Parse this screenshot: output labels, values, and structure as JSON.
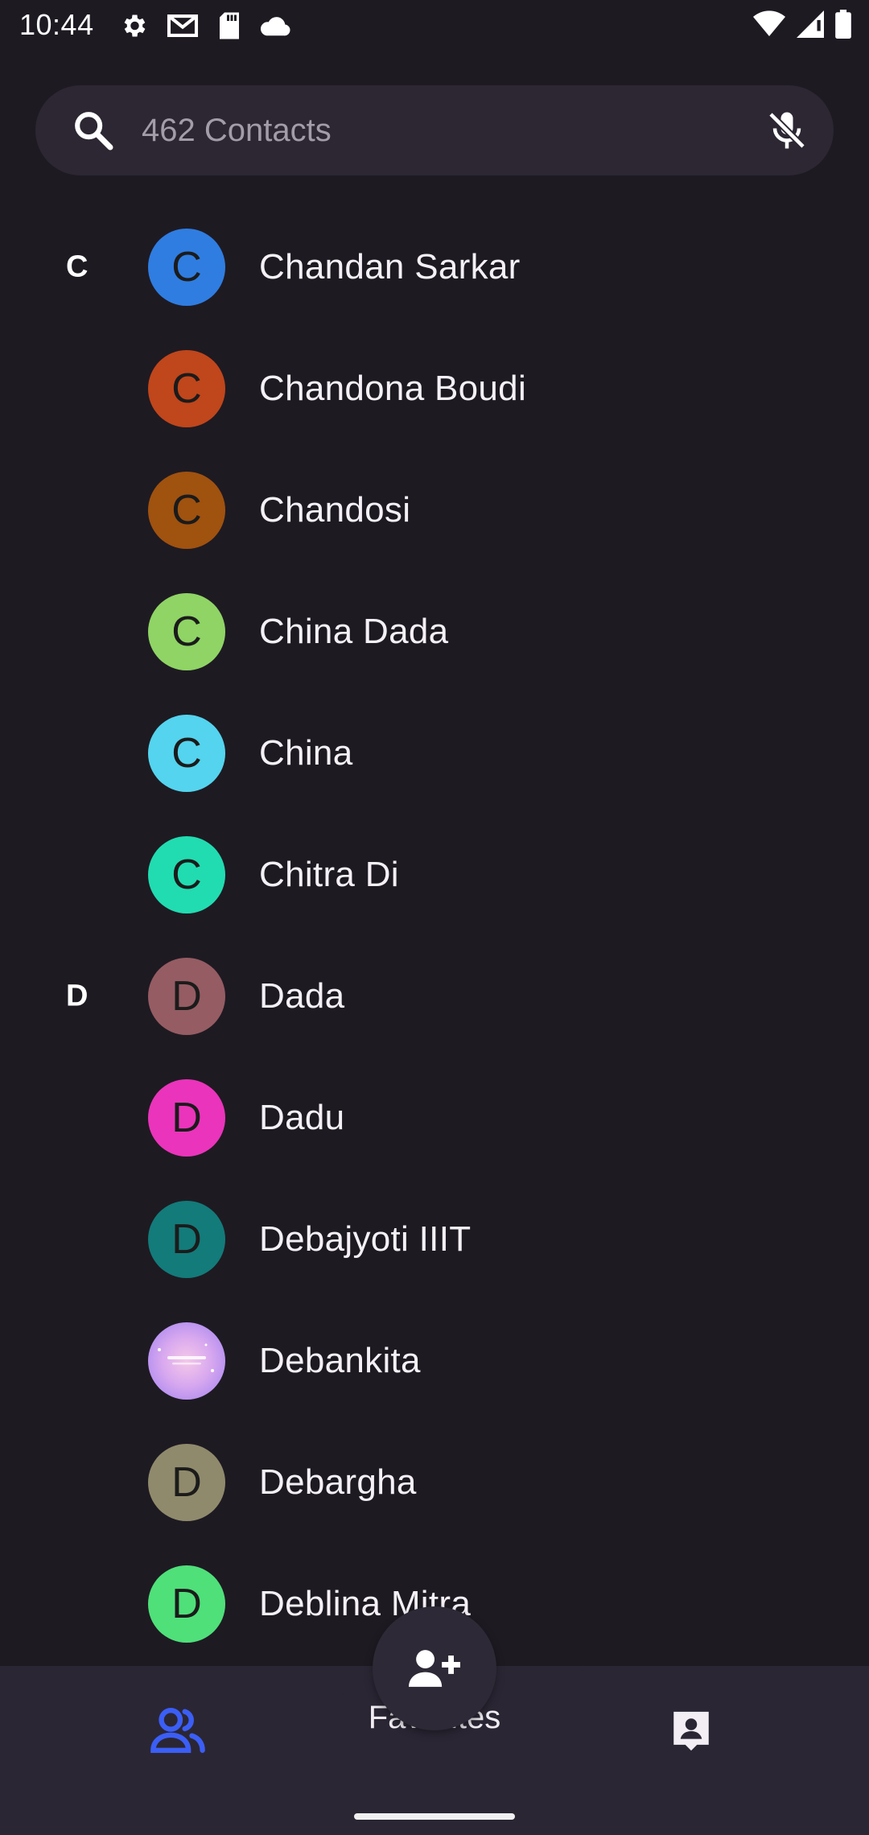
{
  "status_bar": {
    "time": "10:44",
    "left_icons": [
      "settings-icon",
      "gmail-icon",
      "sd-card-icon",
      "cloud-icon"
    ],
    "right_icons": [
      "wifi-icon",
      "signal-icon",
      "battery-icon"
    ]
  },
  "search": {
    "placeholder": "462 Contacts",
    "value": "",
    "mic_icon": "mic-off-icon"
  },
  "contacts": [
    {
      "section": "C",
      "initial": "C",
      "name": "Chandan Sarkar",
      "color": "#2f7de1"
    },
    {
      "section": "",
      "initial": "C",
      "name": "Chandona Boudi",
      "color": "#c0461b"
    },
    {
      "section": "",
      "initial": "C",
      "name": "Chandosi",
      "color": "#a0520f"
    },
    {
      "section": "",
      "initial": "C",
      "name": "China Dada",
      "color": "#8fd465"
    },
    {
      "section": "",
      "initial": "C",
      "name": "China",
      "color": "#54d4ee"
    },
    {
      "section": "",
      "initial": "C",
      "name": "Chitra Di",
      "color": "#21dcb1"
    },
    {
      "section": "D",
      "initial": "D",
      "name": "Dada",
      "color": "#955c63"
    },
    {
      "section": "",
      "initial": "D",
      "name": "Dadu",
      "color": "#ea34bb"
    },
    {
      "section": "",
      "initial": "D",
      "name": "Debajyoti IIIT",
      "color": "#137b7a"
    },
    {
      "section": "",
      "initial": "",
      "name": "Debankita",
      "color": "#d7a7ef",
      "photo": true
    },
    {
      "section": "",
      "initial": "D",
      "name": "Debargha",
      "color": "#8f8a6c"
    },
    {
      "section": "",
      "initial": "D",
      "name": "Deblina Mitra",
      "color": "#4fe07a"
    }
  ],
  "bottom_nav": {
    "contacts_icon": "people-icon",
    "favorites_label": "Favorites",
    "profile_icon": "contact-card-icon",
    "fab_icon": "add-person-icon",
    "active_color": "#3b5ef5"
  }
}
